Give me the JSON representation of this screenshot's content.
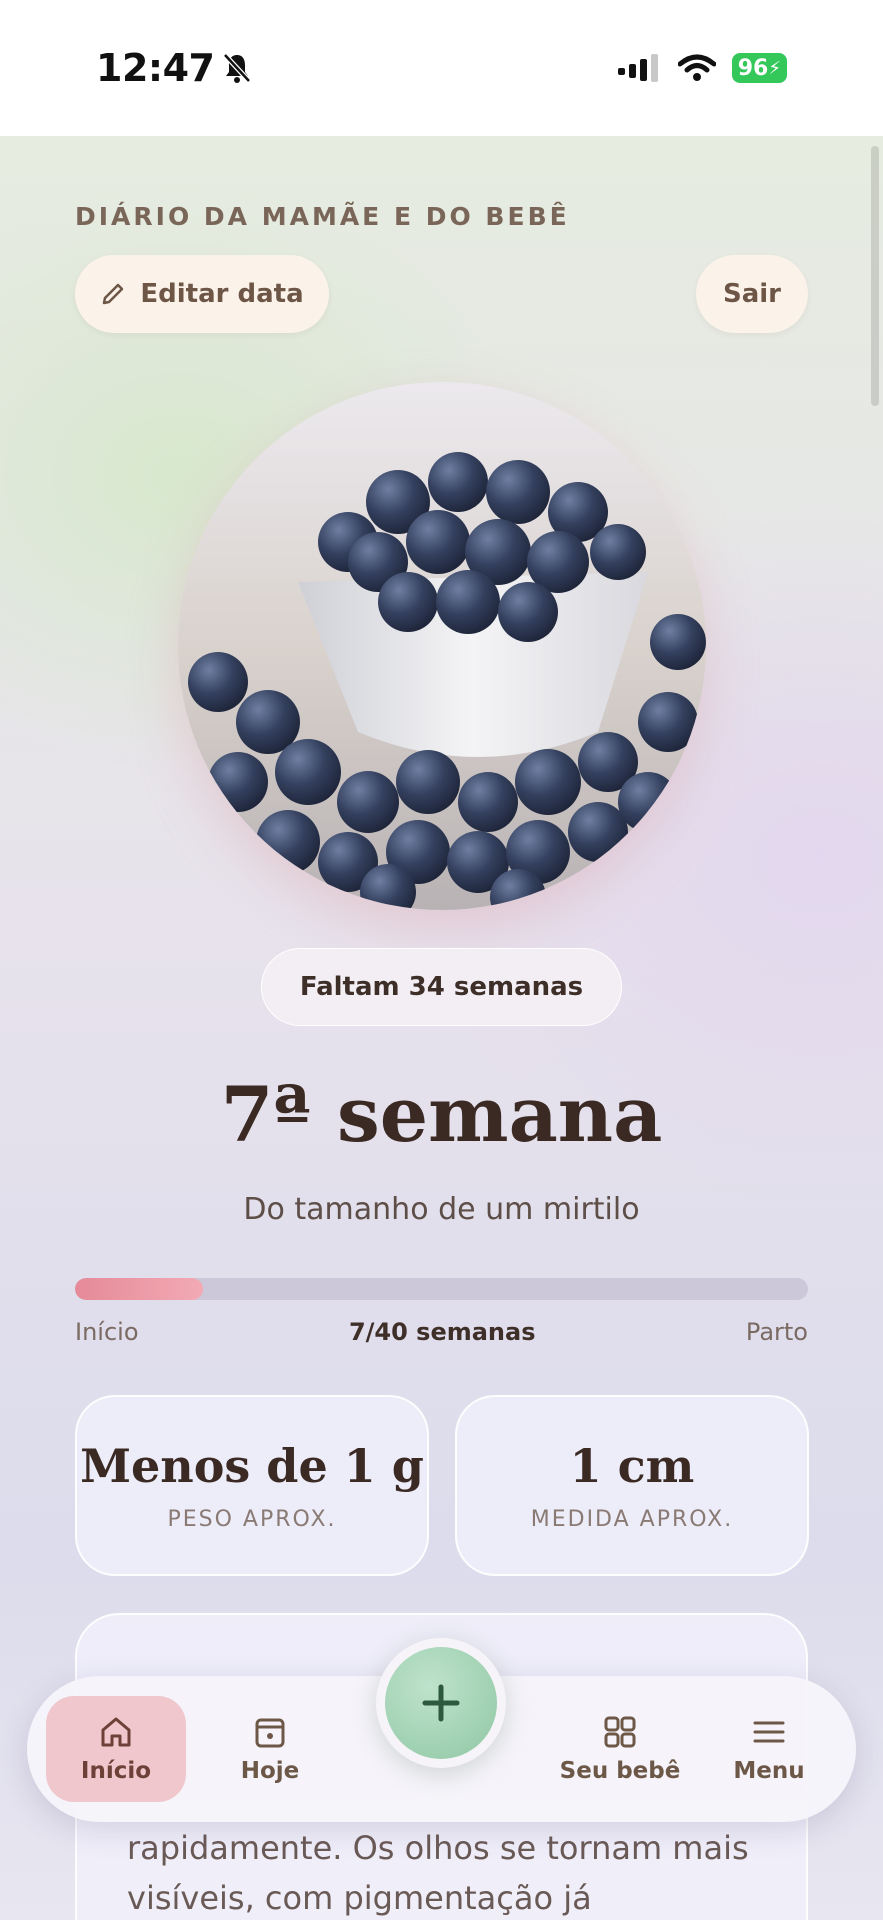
{
  "status_bar": {
    "time": "12:47",
    "battery": "96"
  },
  "header": {
    "app_title": "DIÁRIO DA MAMÃE E DO BEBÊ",
    "edit_date_label": "Editar data",
    "logout_label": "Sair"
  },
  "hero": {
    "image": "blueberries-in-bowl"
  },
  "countdown": {
    "label": "Faltam 34 semanas"
  },
  "week": {
    "title": "7ª semana",
    "size_comparison": "Do tamanho de um mirtilo"
  },
  "progress": {
    "current_week": 7,
    "total_weeks": 40,
    "start_label": "Início",
    "center_label": "7/40 semanas",
    "end_label": "Parto"
  },
  "stats": [
    {
      "value": "Menos de 1 g",
      "label": "PESO APROX."
    },
    {
      "value": "1 cm",
      "label": "MEDIDA APROX."
    }
  ],
  "info_card": {
    "text": "rapidamente. Os olhos se tornam mais visíveis, com pigmentação já"
  },
  "bottom_nav": {
    "items": [
      {
        "label": "Início",
        "icon": "home-icon",
        "active": true
      },
      {
        "label": "Hoje",
        "icon": "calendar-icon",
        "active": false
      },
      {
        "label": "Seu bebê",
        "icon": "grid-icon",
        "active": false
      },
      {
        "label": "Menu",
        "icon": "menu-icon",
        "active": false
      }
    ],
    "fab_icon": "plus-icon"
  },
  "colors": {
    "accent_green": "#8fc7a4",
    "progress_pink": "#e58a98",
    "text_brown": "#3b2a23",
    "active_nav": "#efc7cc"
  }
}
